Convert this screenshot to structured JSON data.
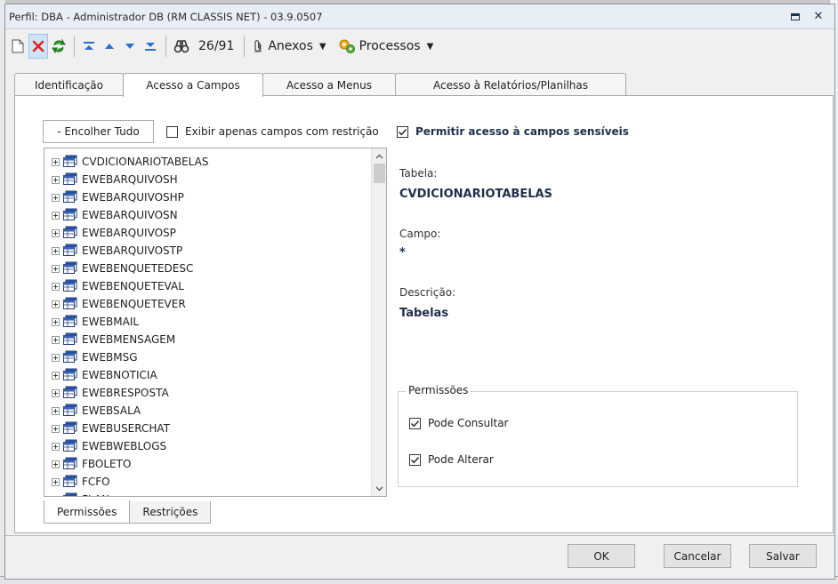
{
  "window": {
    "title": "Perfil: DBA - Administrador DB (RM CLASSIS NET) - 03.9.0507",
    "maximize_icon": "maximize-icon",
    "close_label": "✕"
  },
  "toolbar": {
    "record_counter": "26/91",
    "anexos_label": "Anexos",
    "processos_label": "Processos"
  },
  "tabs": [
    {
      "label": "Identificação"
    },
    {
      "label": "Acesso a Campos"
    },
    {
      "label": "Acesso a Menus"
    },
    {
      "label": "Acesso à Relatórios/Planilhas"
    }
  ],
  "fields_panel": {
    "collapse_all_label": "- Encolher Tudo",
    "only_restricted_label": "Exibir apenas campos com restrição",
    "only_restricted_checked": false,
    "sensitive_access_label": "Permitir acesso à campos sensíveis",
    "sensitive_access_checked": true
  },
  "tree": {
    "items": [
      "CVDICIONARIOTABELAS",
      "EWEBARQUIVOSH",
      "EWEBARQUIVOSHP",
      "EWEBARQUIVOSN",
      "EWEBARQUIVOSP",
      "EWEBARQUIVOSTP",
      "EWEBENQUETEDESC",
      "EWEBENQUETEVAL",
      "EWEBENQUETEVER",
      "EWEBMAIL",
      "EWEBMENSAGEM",
      "EWEBMSG",
      "EWEBNOTICIA",
      "EWEBRESPOSTA",
      "EWEBSALA",
      "EWEBUSERCHAT",
      "EWEBWEBLOGS",
      "FBOLETO",
      "FCFO",
      "FLAN"
    ]
  },
  "details": {
    "table_label": "Tabela:",
    "table_value": "CVDICIONARIOTABELAS",
    "field_label": "Campo:",
    "field_value": "*",
    "description_label": "Descrição:",
    "description_value": "Tabelas"
  },
  "permissions": {
    "legend": "Permissões",
    "can_query_label": "Pode Consultar",
    "can_query_checked": true,
    "can_edit_label": "Pode Alterar",
    "can_edit_checked": true
  },
  "bottom_tabs": [
    {
      "label": "Permissões"
    },
    {
      "label": "Restrições"
    }
  ],
  "dialog_buttons": {
    "ok": "OK",
    "cancel": "Cancelar",
    "save": "Salvar"
  },
  "colors": {
    "accent_text": "#1f2f4a",
    "selected_toolbar_bg": "#cfe3f7",
    "titlebar_bg": "#e9eef5"
  }
}
